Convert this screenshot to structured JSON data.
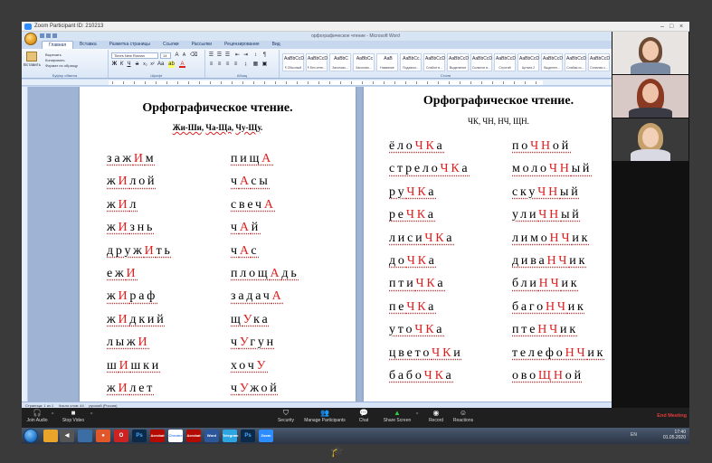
{
  "zoom": {
    "window_title": "Zoom Participant ID: 210213",
    "controls": {
      "join_audio": "Join Audio",
      "stop_video": "Stop Video",
      "security": "Security",
      "manage_participants": "Manage Participants",
      "chat": "Chat",
      "share_screen": "Share Screen",
      "record": "Record",
      "reactions": "Reactions",
      "end_meeting": "End Meeting"
    }
  },
  "word": {
    "title": "орфографическое чтение - Microsoft Word",
    "tabs": [
      "Главная",
      "Вставка",
      "Разметка страницы",
      "Ссылки",
      "Рассылки",
      "Рецензирование",
      "Вид"
    ],
    "clipboard": {
      "paste": "Вставить",
      "cut": "Вырезать",
      "copy": "Копировать",
      "format": "Формат по образцу",
      "group": "Буфер обмена"
    },
    "font": {
      "name": "Times New Roman",
      "size": "14",
      "group": "Шрифт"
    },
    "paragraph_group": "Абзац",
    "styles_group": "Стили",
    "styles": [
      {
        "sample": "AaBbCcDc",
        "name": "¶ Обычный"
      },
      {
        "sample": "AaBbCcDc",
        "name": "¶ Без инте..."
      },
      {
        "sample": "AaBbC",
        "name": "Заголово..."
      },
      {
        "sample": "AaBbCc",
        "name": "Заголово..."
      },
      {
        "sample": "AaB",
        "name": "Название"
      },
      {
        "sample": "AaBbCc.",
        "name": "Подзагол..."
      },
      {
        "sample": "AaBbCcDc",
        "name": "Слабое в..."
      },
      {
        "sample": "AaBbCcDc",
        "name": "Выделение"
      },
      {
        "sample": "AaBbCcDc",
        "name": "Сильное в..."
      },
      {
        "sample": "AaBbCcDc",
        "name": "Строгий"
      },
      {
        "sample": "AaBbCcDc",
        "name": "Цитата 2"
      },
      {
        "sample": "AaBbCcDc",
        "name": "Выделен..."
      },
      {
        "sample": "AaBbCcDc",
        "name": "Слабая сс..."
      },
      {
        "sample": "AaBbCcDc",
        "name": "Сильная с..."
      }
    ],
    "status": {
      "page": "Страница: 1 из 1",
      "words": "Число слов: 44",
      "lang": "русский (Россия)"
    }
  },
  "page1": {
    "title": "Орфографическое чтение.",
    "subtitle": [
      "Жи-Ши",
      ", ",
      "Ча-Ща",
      ", ",
      "Чу-Щу",
      "."
    ],
    "left": [
      [
        [
          "заж",
          0
        ],
        [
          "И",
          1
        ],
        [
          "м",
          0
        ]
      ],
      [
        [
          "ж",
          0
        ],
        [
          "И",
          1
        ],
        [
          "лой",
          0
        ]
      ],
      [
        [
          "ж",
          0
        ],
        [
          "И",
          1
        ],
        [
          "л",
          0
        ]
      ],
      [
        [
          "ж",
          0
        ],
        [
          "И",
          1
        ],
        [
          "знь",
          0
        ]
      ],
      [
        [
          "друж",
          0
        ],
        [
          "И",
          1
        ],
        [
          "ть",
          0
        ]
      ],
      [
        [
          "еж",
          0
        ],
        [
          "И",
          1
        ]
      ],
      [
        [
          "ж",
          0
        ],
        [
          "И",
          1
        ],
        [
          "раф",
          0
        ]
      ],
      [
        [
          "ж",
          0
        ],
        [
          "И",
          1
        ],
        [
          "дкий",
          0
        ]
      ],
      [
        [
          "лыж",
          0
        ],
        [
          "И",
          1
        ]
      ],
      [
        [
          "ш",
          0
        ],
        [
          "И",
          1
        ],
        [
          "шки",
          0
        ]
      ],
      [
        [
          "ж",
          0
        ],
        [
          "И",
          1
        ],
        [
          "лет",
          0
        ]
      ]
    ],
    "right": [
      [
        [
          "пищ",
          0
        ],
        [
          "А",
          1
        ]
      ],
      [
        [
          "ч",
          0
        ],
        [
          "А",
          1
        ],
        [
          "сы",
          0
        ]
      ],
      [
        [
          "свеч",
          0
        ],
        [
          "А",
          1
        ]
      ],
      [
        [
          "ч",
          0
        ],
        [
          "А",
          1
        ],
        [
          "й",
          0
        ]
      ],
      [
        [
          "ч",
          0
        ],
        [
          "А",
          1
        ],
        [
          "с",
          0
        ]
      ],
      [
        [
          "площ",
          0
        ],
        [
          "А",
          1
        ],
        [
          "дь",
          0
        ]
      ],
      [
        [
          "задач",
          0
        ],
        [
          "А",
          1
        ]
      ],
      [
        [
          "щ",
          0
        ],
        [
          "У",
          1
        ],
        [
          "ка",
          0
        ]
      ],
      [
        [
          "ч",
          0
        ],
        [
          "У",
          1
        ],
        [
          "гун",
          0
        ]
      ],
      [
        [
          "хоч",
          0
        ],
        [
          "У",
          1
        ]
      ],
      [
        [
          "ч",
          0
        ],
        [
          "У",
          1
        ],
        [
          "жой",
          0
        ]
      ]
    ]
  },
  "page2": {
    "title": "Орфографическое чтение.",
    "subtitle": "ЧК, ЧН, НЧ, ЩН.",
    "left": [
      [
        [
          "ёло",
          0
        ],
        [
          "ЧК",
          1
        ],
        [
          "а",
          0
        ]
      ],
      [
        [
          "стрело",
          0
        ],
        [
          "ЧК",
          1
        ],
        [
          "а",
          0
        ]
      ],
      [
        [
          "ру",
          0
        ],
        [
          "ЧК",
          1
        ],
        [
          "а",
          0
        ]
      ],
      [
        [
          "ре",
          0
        ],
        [
          "ЧК",
          1
        ],
        [
          "а",
          0
        ]
      ],
      [
        [
          "лиси",
          0
        ],
        [
          "ЧК",
          1
        ],
        [
          "а",
          0
        ]
      ],
      [
        [
          "до",
          0
        ],
        [
          "ЧК",
          1
        ],
        [
          "а",
          0
        ]
      ],
      [
        [
          "пти",
          0
        ],
        [
          "ЧК",
          1
        ],
        [
          "а",
          0
        ]
      ],
      [
        [
          "пе",
          0
        ],
        [
          "ЧК",
          1
        ],
        [
          "а",
          0
        ]
      ],
      [
        [
          "уто",
          0
        ],
        [
          "ЧК",
          1
        ],
        [
          "а",
          0
        ]
      ],
      [
        [
          "цвето",
          0
        ],
        [
          "ЧК",
          1
        ],
        [
          "и",
          0
        ]
      ],
      [
        [
          "бабо",
          0
        ],
        [
          "ЧК",
          1
        ],
        [
          "а",
          0
        ]
      ]
    ],
    "right": [
      [
        [
          "по",
          0
        ],
        [
          "ЧН",
          1
        ],
        [
          "ой",
          0
        ]
      ],
      [
        [
          "моло",
          0
        ],
        [
          "ЧН",
          1
        ],
        [
          "ый",
          0
        ]
      ],
      [
        [
          "ску",
          0
        ],
        [
          "ЧН",
          1
        ],
        [
          "ый",
          0
        ]
      ],
      [
        [
          "ули",
          0
        ],
        [
          "ЧН",
          1
        ],
        [
          "ый",
          0
        ]
      ],
      [
        [
          "лимо",
          0
        ],
        [
          "НЧ",
          1
        ],
        [
          "ик",
          0
        ]
      ],
      [
        [
          "дива",
          0
        ],
        [
          "НЧ",
          1
        ],
        [
          "ик",
          0
        ]
      ],
      [
        [
          "бли",
          0
        ],
        [
          "НЧ",
          1
        ],
        [
          "ик",
          0
        ]
      ],
      [
        [
          "баго",
          0
        ],
        [
          "НЧ",
          1
        ],
        [
          "ик",
          0
        ]
      ],
      [
        [
          "пте",
          0
        ],
        [
          "НЧ",
          1
        ],
        [
          "ик",
          0
        ]
      ],
      [
        [
          "телефо",
          0
        ],
        [
          "НЧ",
          1
        ],
        [
          "ик",
          0
        ]
      ],
      [
        [
          "ово",
          0
        ],
        [
          "ЩН",
          1
        ],
        [
          "ой",
          0
        ]
      ]
    ]
  },
  "taskbar": {
    "lang": "EN",
    "time": "17:40",
    "date": "01.05.2020",
    "apps": [
      "Ps",
      "Acrobat",
      "Chrome",
      "Acrobat",
      "Word",
      "Telegram",
      "Ps",
      "Zoom"
    ]
  },
  "colors": {
    "highlight": "#e02020",
    "zoom_blue": "#2d8cff",
    "end_red": "#e23b3b"
  }
}
